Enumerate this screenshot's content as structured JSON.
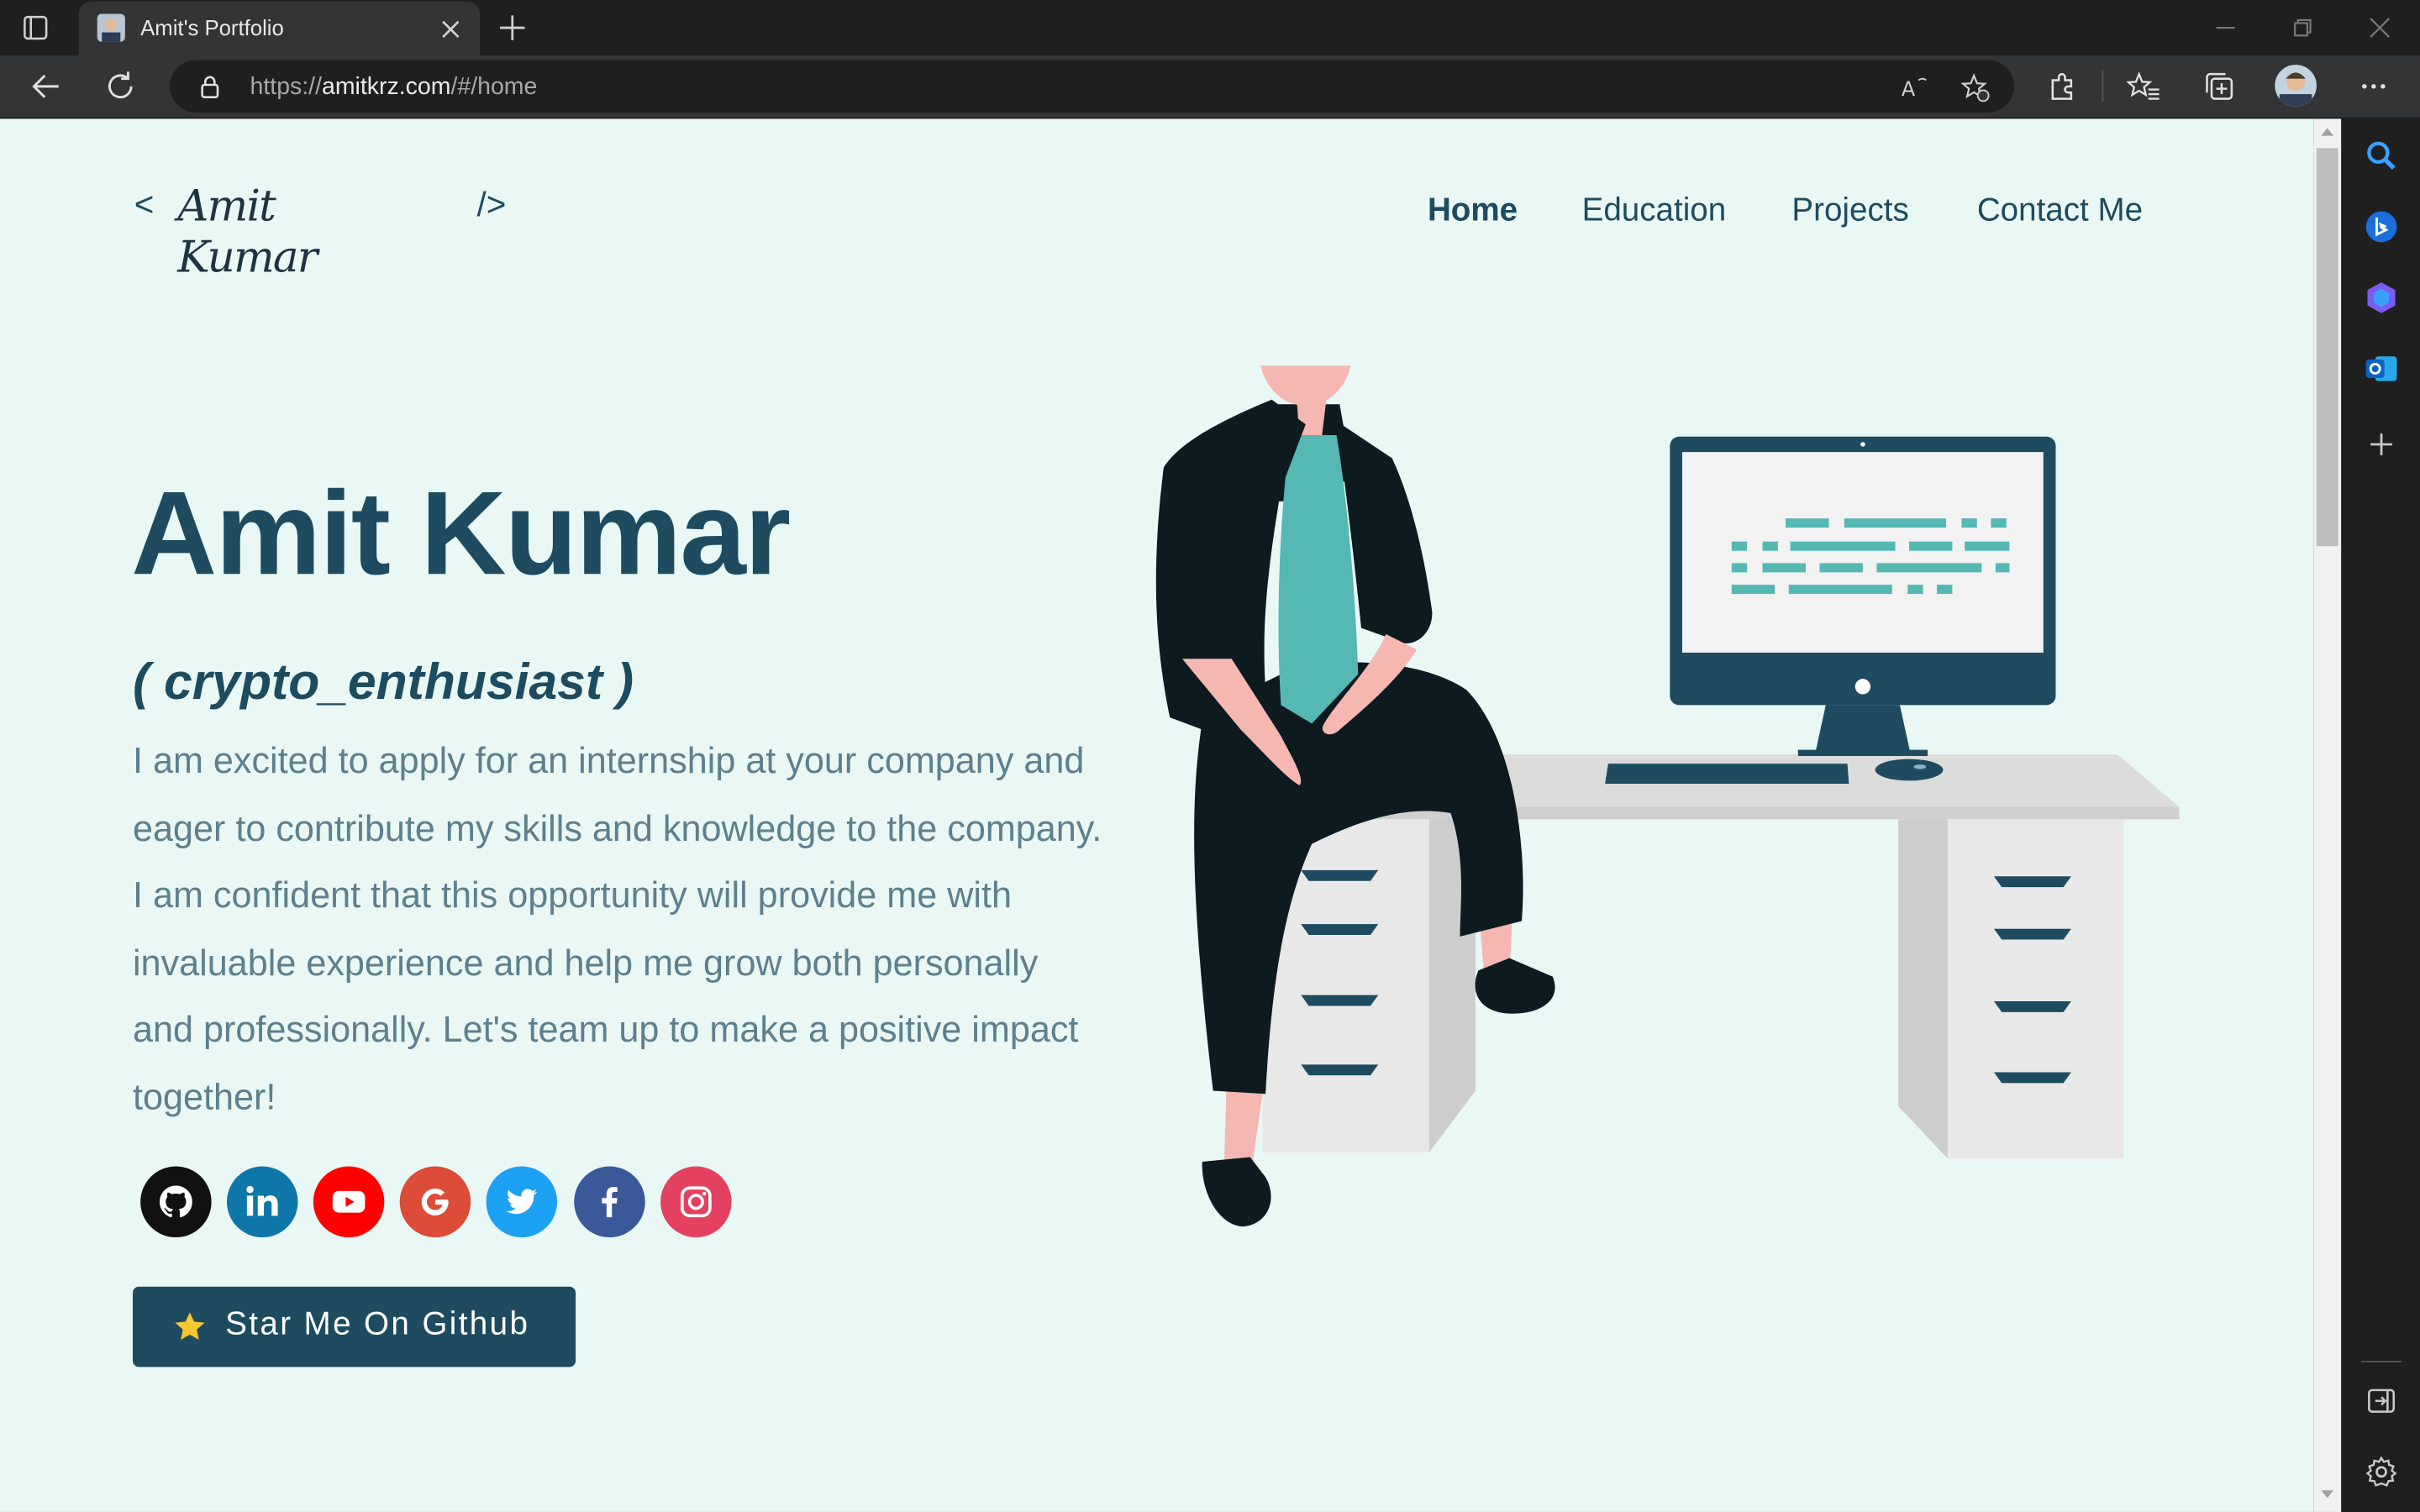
{
  "browser": {
    "tab_title": "Amit's Portfolio",
    "url_scheme": "https://",
    "url_host": "amitkrz.com",
    "url_path": "/#/home"
  },
  "site": {
    "logo_open": "<",
    "logo_signature": "Amit Kumar",
    "logo_close": "/>",
    "nav": [
      {
        "label": "Home",
        "active": true
      },
      {
        "label": "Education",
        "active": false
      },
      {
        "label": "Projects",
        "active": false
      },
      {
        "label": "Contact Me",
        "active": false
      }
    ],
    "hero": {
      "name": "Amit Kumar",
      "subtitle": "( crypto_enthusiast )",
      "text": "I am excited to apply for an internship at your company and eager to contribute my skills and knowledge to the company. I am confident that this opportunity will provide me with invaluable experience and help me grow both personally and professionally. Let's team up to make a positive impact together!"
    },
    "social": [
      {
        "icon": "github-icon",
        "color": "#111111"
      },
      {
        "icon": "linkedin-icon",
        "color": "#0e76a8"
      },
      {
        "icon": "youtube-icon",
        "color": "#ff0000"
      },
      {
        "icon": "google-icon",
        "color": "#dd4b39"
      },
      {
        "icon": "twitter-icon",
        "color": "#1da1f2"
      },
      {
        "icon": "facebook-icon",
        "color": "#3b5998"
      },
      {
        "icon": "instagram-icon",
        "color": "#e4405f"
      }
    ],
    "star_button": "Star Me On Github"
  },
  "colors": {
    "page_bg": "#e9f8f5",
    "primary": "#1e4b5f",
    "body_text": "#5e7f8d",
    "accent_teal": "#55b8b3"
  }
}
